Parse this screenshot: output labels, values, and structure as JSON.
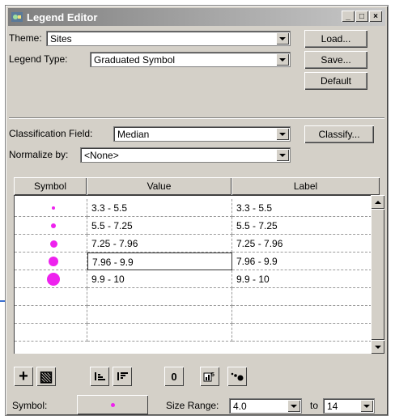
{
  "window": {
    "title": "Legend Editor",
    "buttons": [
      "_",
      "□",
      "×"
    ]
  },
  "theme": {
    "label": "Theme:",
    "value": "Sites"
  },
  "legend_type": {
    "label": "Legend Type:",
    "value": "Graduated Symbol"
  },
  "actions": {
    "load": "Load...",
    "save": "Save...",
    "default": "Default",
    "classify": "Classify..."
  },
  "classification": {
    "label": "Classification Field:",
    "value": "Median"
  },
  "normalize": {
    "label": "Normalize by:",
    "value": "<None>"
  },
  "grid": {
    "headers": [
      "Symbol",
      "Value",
      "Label"
    ],
    "rows": [
      {
        "value": "3.3 - 5.5",
        "label": "3.3 - 5.5",
        "dot_size": 4
      },
      {
        "value": "5.5 - 7.25",
        "label": "5.5 - 7.25",
        "dot_size": 6
      },
      {
        "value": "7.25 - 7.96",
        "label": "7.25 - 7.96",
        "dot_size": 9
      },
      {
        "value": "7.96 - 9.9",
        "label": "7.96 - 9.9",
        "dot_size": 12
      },
      {
        "value": "9.9 - 10",
        "label": "9.9 - 10",
        "dot_size": 16
      },
      {
        "value": "",
        "label": "",
        "dot_size": 0
      },
      {
        "value": "",
        "label": "",
        "dot_size": 0
      },
      {
        "value": "",
        "label": "",
        "dot_size": 0
      }
    ],
    "symbol_color": "#ee22ee"
  },
  "toolbar": {
    "add": "+",
    "delete": "▧",
    "sort_asc": "sort-ascending-icon",
    "sort_desc": "sort-descending-icon",
    "zero": "0",
    "statistics": "statistics-icon",
    "symbols": "graduated-symbols-icon"
  },
  "bottom": {
    "symbol_label": "Symbol:",
    "size_range_label": "Size Range:",
    "size_min": "4.0",
    "to_label": "to",
    "size_max": "14"
  }
}
